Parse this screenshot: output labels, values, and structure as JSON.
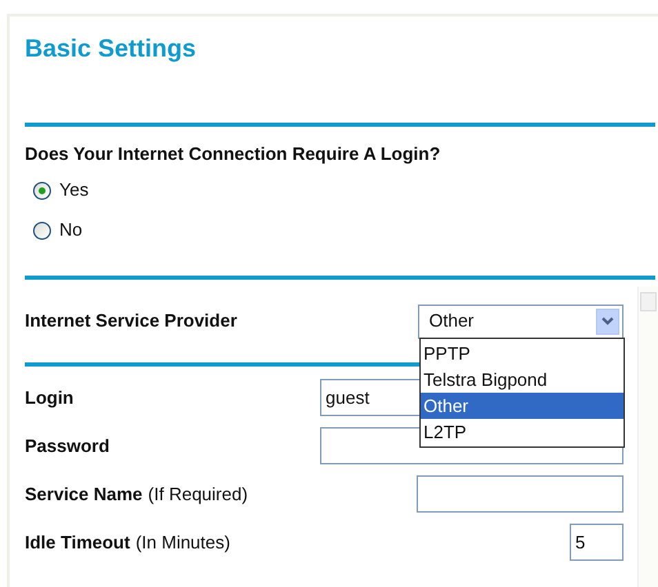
{
  "title": "Basic Settings",
  "login_question": {
    "label": "Does Your Internet Connection Require A Login?",
    "options": [
      {
        "label": "Yes",
        "selected": true
      },
      {
        "label": "No",
        "selected": false
      }
    ]
  },
  "isp": {
    "label": "Internet Service Provider",
    "value": "Other",
    "options": [
      {
        "label": "PPTP",
        "selected": false
      },
      {
        "label": "Telstra Bigpond",
        "selected": false
      },
      {
        "label": "Other",
        "selected": true
      },
      {
        "label": "L2TP",
        "selected": false
      }
    ]
  },
  "fields": [
    {
      "label": "Login",
      "value": "guest",
      "kind": "wide"
    },
    {
      "label": "Password",
      "kind": "wide"
    },
    {
      "label": "Service Name",
      "note": "(If Required)",
      "kind": "medium"
    },
    {
      "label": "Idle Timeout",
      "note": "(In Minutes)",
      "value": "5",
      "kind": "small"
    }
  ]
}
